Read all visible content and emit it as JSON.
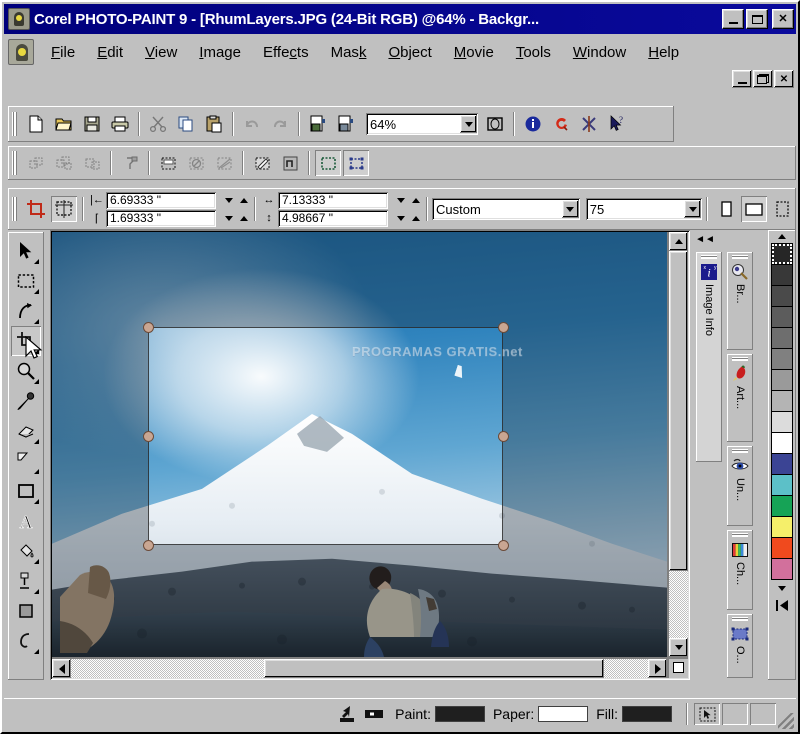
{
  "window": {
    "title": "Corel PHOTO-PAINT 9 - [RhumLayers.JPG (24-Bit RGB) @64% - Backgr...",
    "minimize_label": "_",
    "maximize_label": "□",
    "close_label": "✕",
    "mdi_minimize_label": "_",
    "mdi_restore_label": "❐",
    "mdi_close_label": "✕",
    "titlebar_color": "#00007c",
    "face_color": "#c0c0c0"
  },
  "menu": {
    "items": [
      {
        "label": "File",
        "accel": "F"
      },
      {
        "label": "Edit",
        "accel": "E"
      },
      {
        "label": "View",
        "accel": "V"
      },
      {
        "label": "Image",
        "accel": "I"
      },
      {
        "label": "Effects",
        "accel": "c"
      },
      {
        "label": "Mask",
        "accel": "k"
      },
      {
        "label": "Object",
        "accel": "O"
      },
      {
        "label": "Movie",
        "accel": "M"
      },
      {
        "label": "Tools",
        "accel": "T"
      },
      {
        "label": "Window",
        "accel": "W"
      },
      {
        "label": "Help",
        "accel": "H"
      }
    ]
  },
  "toolbar_main": {
    "buttons": [
      {
        "name": "new-icon",
        "label": "New"
      },
      {
        "name": "open-folder-icon",
        "label": "Open"
      },
      {
        "name": "save-floppy-icon",
        "label": "Save"
      },
      {
        "name": "print-icon",
        "label": "Print"
      },
      {
        "name": "cut-scissors-icon",
        "label": "Cut"
      },
      {
        "name": "copy-icon",
        "label": "Copy"
      },
      {
        "name": "paste-icon",
        "label": "Paste"
      },
      {
        "name": "undo-icon",
        "label": "Undo"
      },
      {
        "name": "redo-icon",
        "label": "Redo"
      },
      {
        "name": "import-icon",
        "label": "Import"
      },
      {
        "name": "export-icon",
        "label": "Export"
      }
    ],
    "zoom_value": "64%",
    "after_zoom_buttons": [
      {
        "name": "zoom-to-fit-icon",
        "label": "Zoom To Fit"
      },
      {
        "name": "info-icon",
        "label": "Application Info"
      },
      {
        "name": "corel-tutor-icon",
        "label": "Corel Tutor"
      },
      {
        "name": "scrapbook-icon",
        "label": "Scrapbook"
      },
      {
        "name": "whats-this-help-icon",
        "label": "What's This Help"
      }
    ]
  },
  "toolbar_mask": {
    "buttons": [
      {
        "name": "object-pick-icon",
        "label": "Object Pick"
      },
      {
        "name": "object-duplicate-icon",
        "label": "Object Duplicate"
      },
      {
        "name": "object-combine-icon",
        "label": "Object Combine"
      },
      {
        "name": "mask-transform-icon",
        "label": "Mask Transform"
      },
      {
        "name": "mask-select-all-icon",
        "label": "Select All"
      },
      {
        "name": "mask-remove-icon",
        "label": "Remove Mask"
      },
      {
        "name": "mask-invert-icon",
        "label": "Invert Mask"
      },
      {
        "name": "paint-on-mask-icon",
        "label": "Paint On Mask"
      },
      {
        "name": "mask-overlay-icon",
        "label": "Mask Overlay"
      },
      {
        "name": "mask-marquee-icon",
        "label": "Marquee Visible"
      },
      {
        "name": "mask-node-edit-icon",
        "label": "Mask Node Edit"
      }
    ]
  },
  "property_bar": {
    "tool_icon_name": "crop-tool-icon",
    "mode_icon_name": "crop-resize-icon",
    "position_x": "6.69333 \"",
    "position_y": "1.69333 \"",
    "width": "7.13333 \"",
    "height": "4.98667 \"",
    "preset": "Custom",
    "angle_or_value": "75",
    "orientation_portrait_name": "portrait-icon",
    "orientation_landscape_name": "landscape-icon",
    "extra_icon_name": "crop-options-icon",
    "labels": {
      "pos_x_icon": "position-left-icon",
      "pos_y_icon": "position-top-icon",
      "width_icon": "width-icon",
      "height_icon": "height-icon"
    }
  },
  "toolbox": {
    "tools": [
      {
        "name": "pick-tool",
        "label": "Pick",
        "flyout": true,
        "active": false
      },
      {
        "name": "mask-rectangle-tool",
        "label": "Rectangle Mask",
        "flyout": true,
        "active": false
      },
      {
        "name": "mask-transform-tool",
        "label": "Mask Transform",
        "flyout": true,
        "active": false
      },
      {
        "name": "crop-tool",
        "label": "Crop",
        "flyout": true,
        "active": true
      },
      {
        "name": "zoom-tool",
        "label": "Zoom",
        "flyout": true,
        "active": false
      },
      {
        "name": "eyedropper-tool",
        "label": "Eyedropper",
        "flyout": false,
        "active": false
      },
      {
        "name": "eraser-tool",
        "label": "Eraser",
        "flyout": true,
        "active": false
      },
      {
        "name": "paint-tool",
        "label": "Paint",
        "flyout": true,
        "active": false
      },
      {
        "name": "rectangle-shape-tool",
        "label": "Rectangle",
        "flyout": true,
        "active": false
      },
      {
        "name": "text-tool",
        "label": "Text",
        "flyout": false,
        "active": false
      },
      {
        "name": "fill-tool",
        "label": "Fill",
        "flyout": true,
        "active": false
      },
      {
        "name": "interactive-fill-tool",
        "label": "Interactive Fill",
        "flyout": true,
        "active": false
      },
      {
        "name": "object-transparency-tool",
        "label": "Object Transparency",
        "flyout": false,
        "active": false
      },
      {
        "name": "path-tool",
        "label": "Path",
        "flyout": true,
        "active": false
      }
    ]
  },
  "canvas": {
    "image_name": "RhumLayers.JPG",
    "watermark_text": "PROGRAMAS GRATIS.net",
    "crop_handles": 8,
    "hscroll": {
      "left_arrow": "◀",
      "right_arrow": "▶"
    },
    "vscroll": {
      "up_arrow": "▲",
      "down_arrow": "▼"
    }
  },
  "dockers": {
    "collapse_label": "◄◄",
    "tabs": [
      {
        "name": "docker-image-info",
        "label": "Image Info",
        "icon": "image-info-icon",
        "selected": true
      },
      {
        "name": "docker-brush-settings",
        "label": "Br...",
        "icon": "brush-settings-icon",
        "selected": false
      },
      {
        "name": "docker-artistic-media",
        "label": "Art...",
        "icon": "artistic-media-icon",
        "selected": false
      },
      {
        "name": "docker-undo",
        "label": "Un...",
        "icon": "undo-docker-icon",
        "selected": false
      },
      {
        "name": "docker-channels",
        "label": "Ch...",
        "icon": "channels-icon",
        "selected": false
      },
      {
        "name": "docker-objects",
        "label": "O...",
        "icon": "objects-icon",
        "selected": false
      }
    ]
  },
  "palette": {
    "scroll_up_label": "▲",
    "scroll_down_label": "▼",
    "to_start_label": "⏮",
    "colors": [
      "#262626",
      "#383838",
      "#4a4a4a",
      "#5c5c5c",
      "#6e6e6e",
      "#808080",
      "#9a9a9a",
      "#b4b4b4",
      "#dcdcdc",
      "#ffffff",
      "#3b4494",
      "#5cc0c8",
      "#16a356",
      "#f5ef6a",
      "#f04a1e",
      "#d governed"
    ],
    "colors_final": [
      "#262626",
      "#383838",
      "#4a4a4a",
      "#5c5c5c",
      "#6e6e6e",
      "#808080",
      "#9a9a9a",
      "#b4b4b4",
      "#dcdcdc",
      "#ffffff",
      "#3b4494",
      "#5cc0c8",
      "#16a356",
      "#f5ef6a",
      "#f04a1e",
      "#d2709c"
    ],
    "selected_index": 0
  },
  "statusbar": {
    "tool_hint_icon": "cursor-position-icon",
    "mode_icon": "color-mode-icon",
    "paint_label": "Paint:",
    "paint_color": "#1f1f1f",
    "paper_label": "Paper:",
    "paper_color": "#ffffff",
    "fill_label": "Fill:",
    "fill_color": "#1f1f1f",
    "indicator_icons": [
      "mask-present-icon",
      "blank-indicator-1",
      "blank-indicator-2"
    ]
  }
}
